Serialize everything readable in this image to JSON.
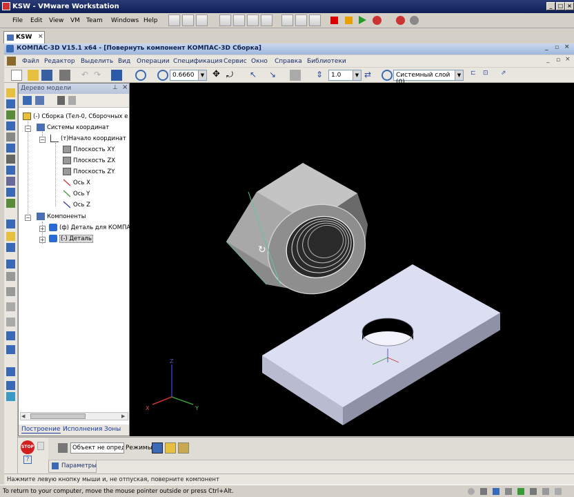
{
  "vm": {
    "title": "KSW - VMware Workstation",
    "menu": [
      "File",
      "Edit",
      "View",
      "VM",
      "Team",
      "Windows",
      "Help"
    ],
    "tab": "KSW",
    "status": "To return to your computer, move the mouse pointer outside or press Ctrl+Alt."
  },
  "kompas": {
    "title": "КОМПАС-3D V15.1 x64 - [Повернуть компонент КОМПАС-3D Сборка]",
    "menu": [
      "Файл",
      "Редактор",
      "Выделить",
      "Вид",
      "Операции",
      "Спецификация",
      "Сервис",
      "Окно",
      "Справка",
      "Библиотеки"
    ],
    "zoom": "0.6660",
    "step": "1.0",
    "layer": "Системный слой (0)"
  },
  "tree": {
    "header": "Дерево модели",
    "root": "(-) Сборка (Тел-0, Сборочных е",
    "coord_systems": "Системы координат",
    "origin": "(т)Начало координат",
    "plane_xy": "Плоскость XY",
    "plane_zx": "Плоскость ZX",
    "plane_zy": "Плоскость ZY",
    "axis_x": "Ось X",
    "axis_y": "Ось Y",
    "axis_z": "Ось Z",
    "components": "Компоненты",
    "comp1": "(ф) Деталь для КОМПА",
    "comp2": "(-) Деталь",
    "tabs": [
      "Построение",
      "Исполнения",
      "Зоны"
    ]
  },
  "bottom": {
    "object_field": "Объект не опреде",
    "modes_label": "Режимы",
    "params_tab": "Параметры",
    "stop_label": "STOP"
  },
  "axes": {
    "x": "X",
    "y": "Y",
    "z": "Z"
  },
  "statusbar": "Нажмите левую кнопку мыши и, не отпуская, поверните компонент",
  "colors": {
    "viewport_bg": "#000000",
    "part_face": "#d8dbf0",
    "nut_face": "#c8c8c8"
  }
}
